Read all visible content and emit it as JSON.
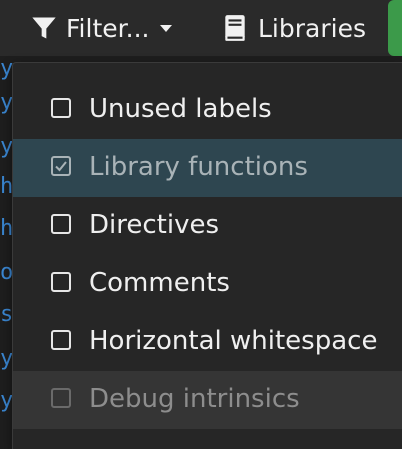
{
  "toolbar": {
    "filter_label": "Filter...",
    "libraries_label": "Libraries",
    "accent_color": "#3c9a4a"
  },
  "filter_menu": {
    "items": [
      {
        "label": "Unused labels",
        "checked": false,
        "state": "normal"
      },
      {
        "label": "Library functions",
        "checked": true,
        "state": "active"
      },
      {
        "label": "Directives",
        "checked": false,
        "state": "normal"
      },
      {
        "label": "Comments",
        "checked": false,
        "state": "normal"
      },
      {
        "label": "Horizontal whitespace",
        "checked": false,
        "state": "normal"
      },
      {
        "label": "Debug intrinsics",
        "checked": false,
        "state": "disabled"
      }
    ]
  },
  "gutter": {
    "chars": [
      "y",
      "y",
      "y",
      "h",
      "h",
      "o",
      "s",
      "y",
      "y"
    ]
  },
  "icons": [
    "filter-icon",
    "chevron-down-icon",
    "book-icon",
    "checkbox-icon",
    "check-icon"
  ]
}
